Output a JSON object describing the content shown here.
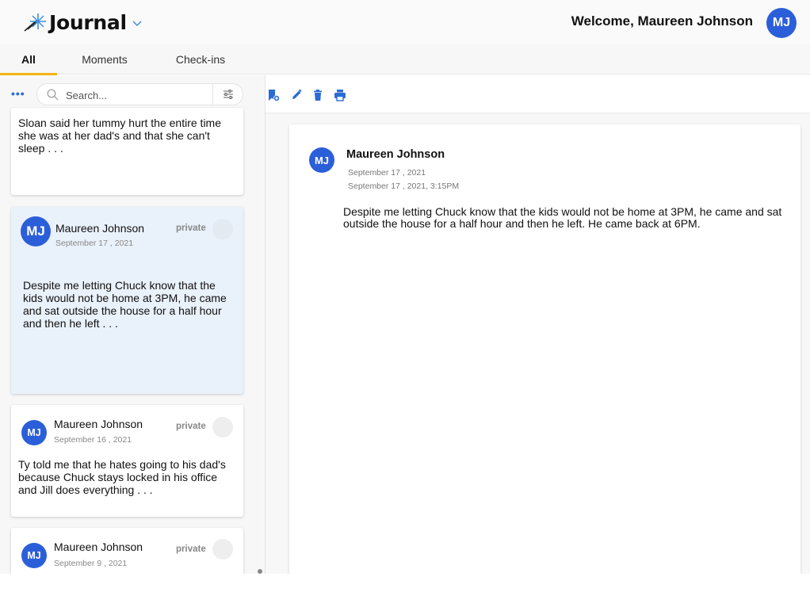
{
  "app": {
    "title": "Journal",
    "welcome": "Welcome, Maureen Johnson",
    "user_initials": "MJ",
    "accent_color": "#2b5ed9",
    "tab_indicator_color": "#f5b417"
  },
  "tabs": [
    {
      "label": "All",
      "active": true
    },
    {
      "label": "Moments",
      "active": false
    },
    {
      "label": "Check-ins",
      "active": false
    }
  ],
  "left_toolbar": {
    "more_label": "•••",
    "search_placeholder": "Search...",
    "search_icon": "search-icon",
    "filter_icon": "sliders-icon"
  },
  "entries": [
    {
      "snippet": "Sloan said her tummy hurt the entire time she was at her dad's and that she can't sleep . . ."
    },
    {
      "initials": "MJ",
      "author": "Maureen Johnson",
      "date": "September 17 , 2021",
      "visibility": "private",
      "snippet": "Despite me letting Chuck know that the kids would not be home at 3PM, he came and sat outside the house for a half hour and then he left . . .",
      "selected": true
    },
    {
      "initials": "MJ",
      "author": "Maureen Johnson",
      "date": "September 16 , 2021",
      "visibility": "private",
      "snippet": "Ty told me that he hates going to his dad's because Chuck stays locked in his office and Jill does everything . . ."
    },
    {
      "initials": "MJ",
      "author": "Maureen Johnson",
      "date": "September 9 , 2021",
      "visibility": "private"
    }
  ],
  "right_toolbar": {
    "icons": [
      "add-bookmark-icon",
      "edit-icon",
      "delete-icon",
      "print-icon"
    ]
  },
  "detail": {
    "initials": "MJ",
    "author": "Maureen Johnson",
    "date": "September 17 , 2021",
    "datetime": "September 17 , 2021, 3:15PM",
    "body": "Despite me letting Chuck know that the kids would not be home at 3PM, he came and sat outside the house for a half hour and then he left. He came back at 6PM."
  }
}
